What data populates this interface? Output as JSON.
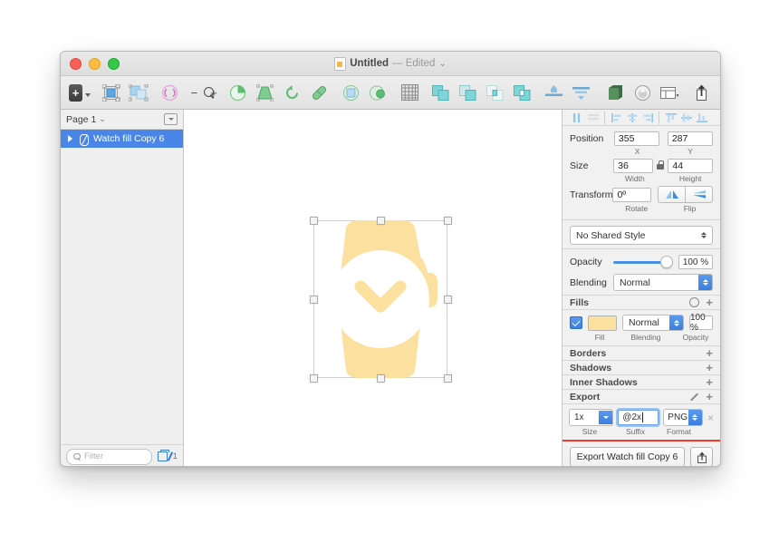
{
  "window": {
    "title": "Untitled",
    "edited_label": "— Edited",
    "chevron": "⌄",
    "doc_icon": "document-icon"
  },
  "toolbar": {
    "insert_label": "+",
    "zoom_out": "−",
    "zoom_in": "+",
    "icons": [
      "insert-icon",
      "scale-icon",
      "group-icon",
      "rotate-copies-icon",
      "mask-icon",
      "trapezoid-icon",
      "rotate-icon",
      "pill-icon",
      "union-icon",
      "subtract-icon",
      "grid-icon",
      "boolean-union-icon",
      "boolean-subtract-icon",
      "boolean-intersect-icon",
      "boolean-difference-icon",
      "align-objects-icon",
      "distribute-objects-icon",
      "make-symbol-icon",
      "cloud-icon",
      "view-layout-icon",
      "export-share-icon"
    ]
  },
  "sidebar": {
    "page_label": "Page 1",
    "page_chevron": "⌄",
    "page_menu_icon": "page-menu-icon",
    "layers": [
      {
        "name": "Watch fill Copy 6",
        "selected": true,
        "icon": "watch-layer-icon"
      }
    ],
    "filter_placeholder": "Filter",
    "filter_value": "",
    "layer_count": "1"
  },
  "canvas": {
    "artwork_name": "watch-icon-artwork",
    "fill_color": "#FCE0A0",
    "selection_handles": 8
  },
  "inspector": {
    "align_buttons": [
      "align-left-icon",
      "align-center-horizontal-icon",
      "align-left-edges-icon",
      "align-centers-icon",
      "align-right-edges-icon",
      "align-top-edges-icon",
      "align-middles-icon",
      "align-bottom-edges-icon"
    ],
    "position": {
      "label": "Position",
      "x_value": "355",
      "y_value": "287",
      "x_sublabel": "X",
      "y_sublabel": "Y"
    },
    "size": {
      "label": "Size",
      "width_value": "36",
      "height_value": "44",
      "width_sublabel": "Width",
      "height_sublabel": "Height",
      "lock_icon": "lock-proportions-icon"
    },
    "transform": {
      "label": "Transform",
      "rotate_value": "0º",
      "rotate_sublabel": "Rotate",
      "flip_sublabel": "Flip",
      "flip_horizontal_icon": "flip-horizontal-icon",
      "flip_vertical_icon": "flip-vertical-icon"
    },
    "shared_style": {
      "value": "No Shared Style"
    },
    "opacity": {
      "label": "Opacity",
      "value": "100 %",
      "slider_percent": 100
    },
    "blending": {
      "label": "Blending",
      "value": "Normal"
    },
    "fills": {
      "title": "Fills",
      "gear_icon": "gear-icon",
      "add_icon": "plus-icon",
      "enabled": true,
      "color": "#FCE0A0",
      "blending": "Normal",
      "opacity": "100 %",
      "sub_fill": "Fill",
      "sub_blending": "Blending",
      "sub_opacity": "Opacity"
    },
    "borders": {
      "title": "Borders",
      "add_icon": "plus-icon"
    },
    "shadows": {
      "title": "Shadows",
      "add_icon": "plus-icon"
    },
    "inner_shadows": {
      "title": "Inner Shadows",
      "add_icon": "plus-icon"
    },
    "export": {
      "title": "Export",
      "pencil_icon": "pencil-icon",
      "add_icon": "plus-icon",
      "size_value": "1x",
      "suffix_value": "@2x",
      "format_value": "PNG",
      "remove_icon": "×",
      "sub_size": "Size",
      "sub_suffix": "Suffix",
      "sub_format": "Format",
      "export_button_label": "Export Watch fill Copy 6",
      "share_icon": "share-icon",
      "highlight_color": "#F33A2F"
    }
  }
}
